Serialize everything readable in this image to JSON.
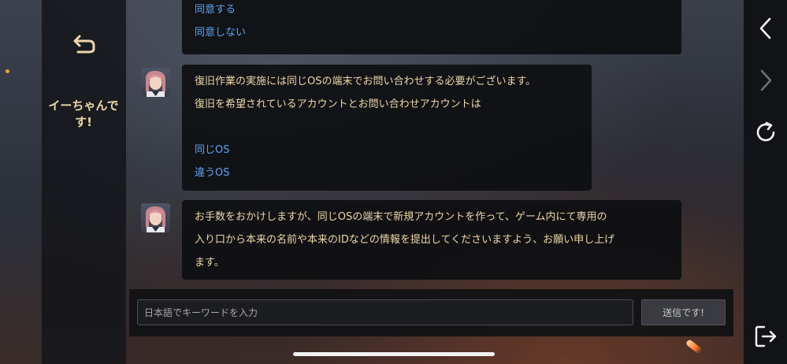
{
  "npc": {
    "name": "イーちゃんです!"
  },
  "messages": [
    {
      "lines": [],
      "choices": [
        "同意する",
        "同意しない"
      ]
    },
    {
      "lines": [
        "復旧作業の実施には同じOSの端末でお問い合わせする必要がございます。",
        "復旧を希望されているアカウントとお問い合わせアカウントは",
        ""
      ],
      "choices": [
        "同じOS",
        "違うOS"
      ]
    },
    {
      "lines": [
        "お手数をおかけしますが、同じOSの端末で新規アカウントを作って、ゲーム内にて専用の",
        "入り口から本来の名前や本来のIDなどの情報を提出してくださいますよう、お願い申し上げ",
        "ます。"
      ],
      "choices": []
    }
  ],
  "input": {
    "placeholder": "日本語でキーワードを入力",
    "value": ""
  },
  "send_button": {
    "label": "送信です!"
  },
  "colors": {
    "text": "#ecd7a9",
    "choice": "#5ba6f2",
    "accent": "#e0a63a"
  },
  "icons": {
    "back": "back-arrow-icon",
    "prev": "chevron-left-icon",
    "next": "chevron-right-icon",
    "reload": "reload-icon",
    "exit": "exit-icon"
  }
}
